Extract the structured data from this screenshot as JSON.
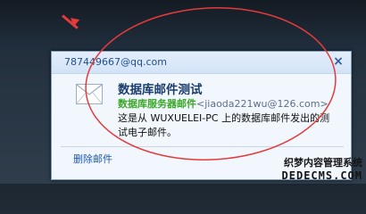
{
  "notification": {
    "sender": "787449667@qq.com",
    "close_glyph": "×",
    "icon": "envelope-icon",
    "subject": "数据库邮件测试",
    "from_name": "数据库服务器邮件",
    "from_addr": "<jiaoda221wu@126.com>",
    "body": "这是从 WUXUELEI-PC 上的数据库邮件发出的测试电子邮件。",
    "delete_label": "删除邮件"
  },
  "watermark": {
    "line1": "织梦内容管理系统",
    "line2": "DEDECMS.COM"
  },
  "colors": {
    "annotation": "#e33b3b",
    "from_name": "#3aa827",
    "link": "#1c57b6"
  }
}
